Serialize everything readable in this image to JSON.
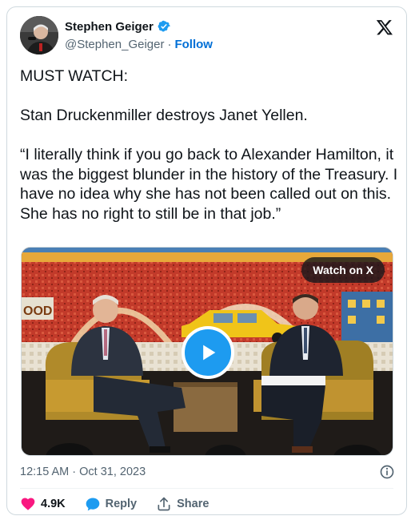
{
  "author": {
    "display_name": "Stephen Geiger",
    "handle": "@Stephen_Geiger",
    "separator": "·",
    "follow_label": "Follow",
    "verified": true
  },
  "tweet": {
    "paragraphs": [
      "MUST WATCH:",
      "Stan Druckenmiller destroys Janet Yellen.",
      "“I literally think if you go back to Alexander Hamilton, it was the biggest blunder in the history of the Treasury. I have no idea why she has not been called out on this. She has no right to still be in that job.”"
    ]
  },
  "media": {
    "watch_label": "Watch on X",
    "background_sign_text": "OOD"
  },
  "meta": {
    "timestamp": "12:15 AM · Oct 31, 2023"
  },
  "actions": {
    "likes_count": "4.9K",
    "reply_label": "Reply",
    "share_label": "Share"
  },
  "colors": {
    "accent": "#1d9bf0",
    "link": "#006fd6",
    "like": "#f91880",
    "text_primary": "#0f1419",
    "text_secondary": "#536471",
    "border": "#cfd9de"
  },
  "icons": [
    "verified-badge-icon",
    "x-logo-icon",
    "play-icon",
    "info-icon",
    "heart-icon",
    "reply-icon",
    "share-icon"
  ]
}
